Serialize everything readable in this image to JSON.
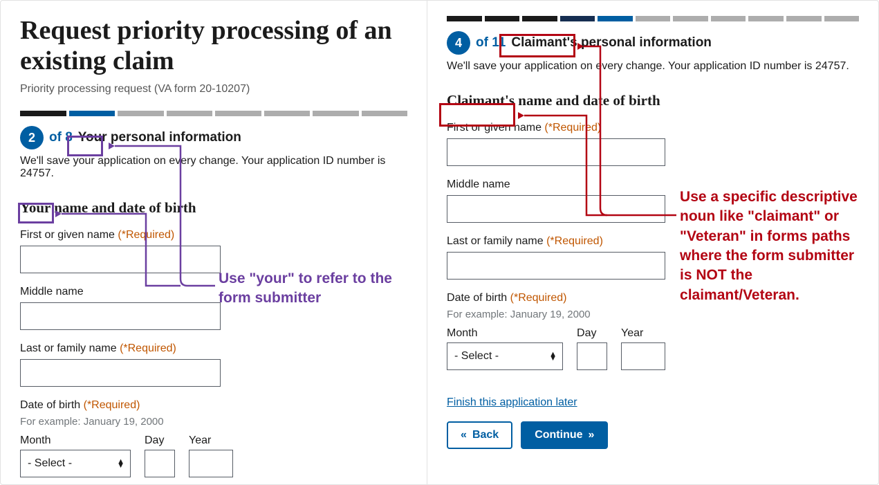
{
  "left": {
    "title": "Request priority processing of an existing claim",
    "subtitle": "Priority processing request (VA form 20-10207)",
    "step_number": "2",
    "step_of": "of 8",
    "step_title": "Your personal information",
    "save_text": "We'll save your application on every change. Your application ID number is 24757.",
    "section_heading": "Your name and date of birth",
    "first_label": "First or given name",
    "middle_label": "Middle name",
    "last_label": "Last or family name",
    "dob_label": "Date of birth",
    "dob_hint": "For example: January 19, 2000",
    "month_label": "Month",
    "day_label": "Day",
    "year_label": "Year",
    "month_placeholder": "- Select -",
    "required_text": "(*Required)"
  },
  "right": {
    "step_number": "4",
    "step_of": "of 11",
    "step_title": "Claimant's personal information",
    "save_text": "We'll save your application on every change. Your application ID number is 24757.",
    "section_heading": "Claimant's name and date of birth",
    "first_label": "First or given name",
    "middle_label": "Middle name",
    "last_label": "Last or family name",
    "dob_label": "Date of birth",
    "dob_hint": "For example: January 19, 2000",
    "month_label": "Month",
    "day_label": "Day",
    "year_label": "Year",
    "month_placeholder": "- Select -",
    "required_text": "(*Required)",
    "finish_link": "Finish this application later",
    "back_btn": "Back",
    "continue_btn": "Continue"
  },
  "annotations": {
    "purple_text": "Use \"your\" to refer to the form submitter",
    "red_text": "Use a specific descriptive noun like \"claimant\" or \"Veteran\" in forms paths where the form submitter is NOT the claimant/Veteran."
  }
}
